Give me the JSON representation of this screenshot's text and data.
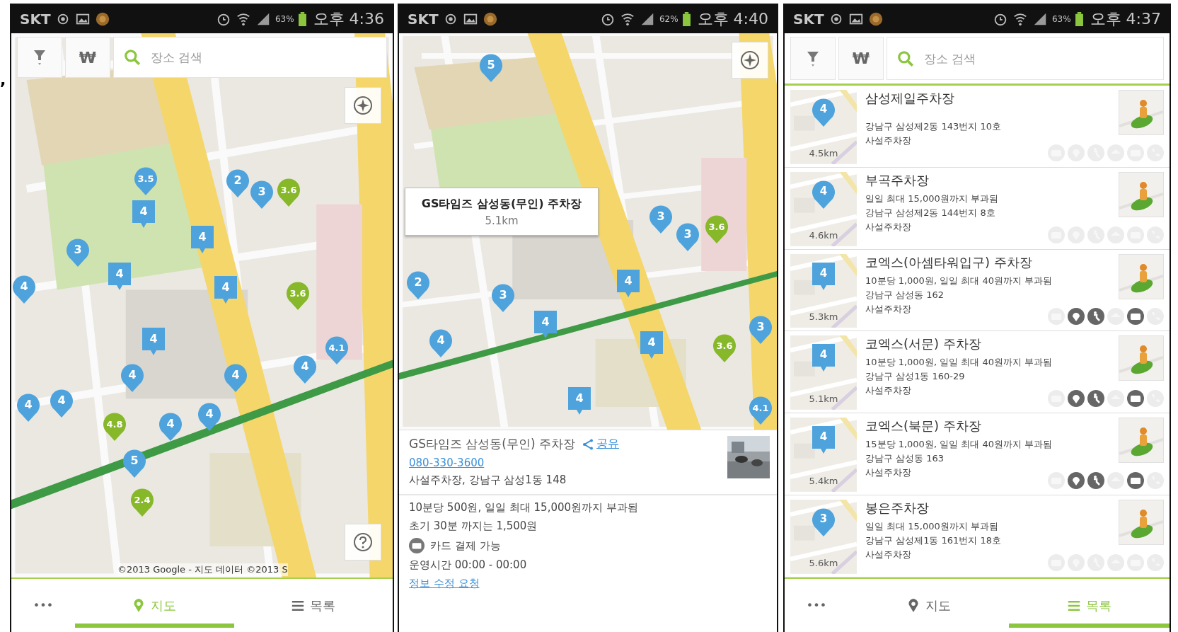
{
  "stray_mark": ",",
  "screens": [
    {
      "kind": "map",
      "status_bar": {
        "carrier": "SKT",
        "battery": "63%",
        "time": "오후 4:36"
      },
      "search": {
        "currency_label": "₩",
        "placeholder": "장소 검색"
      },
      "map": {
        "attribution": "©2013 Google - 지도 데이터 ©2013 S",
        "markers": [
          {
            "value": "3.5",
            "kind": "round",
            "color": "#4ea3dc"
          },
          {
            "value": "4",
            "kind": "square",
            "color": "#4ea3dc"
          },
          {
            "value": "2",
            "kind": "round",
            "color": "#4ea3dc"
          },
          {
            "value": "3",
            "kind": "round",
            "color": "#4ea3dc"
          },
          {
            "value": "3.6",
            "kind": "round",
            "color": "#86b82a"
          },
          {
            "value": "4",
            "kind": "square",
            "color": "#4ea3dc"
          },
          {
            "value": "3",
            "kind": "round",
            "color": "#4ea3dc"
          },
          {
            "value": "4",
            "kind": "square",
            "color": "#4ea3dc"
          },
          {
            "value": "4",
            "kind": "round",
            "color": "#4ea3dc"
          },
          {
            "value": "4",
            "kind": "square",
            "color": "#4ea3dc"
          },
          {
            "value": "3.6",
            "kind": "round",
            "color": "#86b82a"
          },
          {
            "value": "4",
            "kind": "square",
            "color": "#4ea3dc"
          },
          {
            "value": "4",
            "kind": "round",
            "color": "#4ea3dc"
          },
          {
            "value": "4",
            "kind": "round",
            "color": "#4ea3dc"
          },
          {
            "value": "4",
            "kind": "round",
            "color": "#4ea3dc"
          },
          {
            "value": "4.1",
            "kind": "round",
            "color": "#4ea3dc"
          },
          {
            "value": "4",
            "kind": "round",
            "color": "#4ea3dc"
          },
          {
            "value": "4",
            "kind": "round",
            "color": "#4ea3dc"
          },
          {
            "value": "4.8",
            "kind": "round",
            "color": "#86b82a"
          },
          {
            "value": "4",
            "kind": "round",
            "color": "#4ea3dc"
          },
          {
            "value": "4",
            "kind": "round",
            "color": "#4ea3dc"
          },
          {
            "value": "5",
            "kind": "round",
            "color": "#4ea3dc"
          },
          {
            "value": "2.4",
            "kind": "round",
            "color": "#86b82a"
          }
        ]
      },
      "bottom_nav": [
        {
          "kind": "more",
          "label": "•••",
          "selected": false
        },
        {
          "kind": "map",
          "label": "지도",
          "selected": true
        },
        {
          "kind": "list",
          "label": "목록",
          "selected": false
        }
      ]
    },
    {
      "kind": "detail",
      "status_bar": {
        "carrier": "SKT",
        "battery": "62%",
        "time": "오후 4:40"
      },
      "map": {
        "callout": {
          "title": "GS타임즈 삼성동(무인) 주차장",
          "distance": "5.1km"
        },
        "markers": [
          {
            "value": "5",
            "kind": "round",
            "color": "#4ea3dc"
          },
          {
            "value": "2",
            "kind": "round",
            "color": "#4ea3dc"
          },
          {
            "value": "3",
            "kind": "round",
            "color": "#4ea3dc"
          },
          {
            "value": "3",
            "kind": "round",
            "color": "#4ea3dc"
          },
          {
            "value": "3",
            "kind": "round",
            "color": "#4ea3dc"
          },
          {
            "value": "3.6",
            "kind": "round",
            "color": "#86b82a"
          },
          {
            "value": "4",
            "kind": "square",
            "color": "#4ea3dc"
          },
          {
            "value": "4",
            "kind": "square",
            "color": "#4ea3dc"
          },
          {
            "value": "4",
            "kind": "round",
            "color": "#4ea3dc"
          },
          {
            "value": "4",
            "kind": "square",
            "color": "#4ea3dc"
          },
          {
            "value": "3.6",
            "kind": "round",
            "color": "#86b82a"
          },
          {
            "value": "3",
            "kind": "round",
            "color": "#4ea3dc"
          },
          {
            "value": "4",
            "kind": "square",
            "color": "#4ea3dc"
          },
          {
            "value": "4.1",
            "kind": "round",
            "color": "#4ea3dc"
          }
        ]
      },
      "detail": {
        "title": "GS타임즈 삼성동(무인) 주차장",
        "share_label": "공유",
        "phone": "080-330-3600",
        "address": "사설주차장, 강남구 삼성1동 148",
        "info_lines": [
          {
            "kind": "text",
            "text": "10분당 500원, 일일 최대 15,000원까지 부과됨"
          },
          {
            "kind": "text",
            "text": "초기 30분 까지는 1,500원"
          },
          {
            "kind": "card",
            "text": "카드 결제 가능"
          },
          {
            "kind": "text",
            "text": "운영시간 00:00 - 00:00"
          },
          {
            "kind": "link",
            "text": "정보 수정 요청"
          }
        ]
      }
    },
    {
      "kind": "list",
      "status_bar": {
        "carrier": "SKT",
        "battery": "63%",
        "time": "오후 4:37"
      },
      "search": {
        "currency_label": "₩",
        "placeholder": "장소 검색"
      },
      "list": [
        {
          "name": "삼성제일주차장",
          "price": "4",
          "kind": "round",
          "distance": "4.5km",
          "lines": [
            "강남구 삼성제2동 143번지 10호",
            "사설주차장"
          ],
          "features": [
            {
              "kind": "card",
              "on": false
            },
            {
              "kind": "pin",
              "on": false
            },
            {
              "kind": "person",
              "on": false
            },
            {
              "kind": "roof",
              "on": false
            },
            {
              "kind": "pay",
              "on": false
            },
            {
              "kind": "phone",
              "on": false
            }
          ]
        },
        {
          "name": "부곡주차장",
          "price": "4",
          "kind": "round",
          "distance": "4.6km",
          "lines": [
            "일일 최대 15,000원까지 부과됨",
            "강남구 삼성제2동 144번지 8호",
            "사설주차장"
          ],
          "features": [
            {
              "kind": "card",
              "on": false
            },
            {
              "kind": "pin",
              "on": false
            },
            {
              "kind": "person",
              "on": false
            },
            {
              "kind": "roof",
              "on": false
            },
            {
              "kind": "pay",
              "on": false
            },
            {
              "kind": "phone",
              "on": false
            }
          ]
        },
        {
          "name": "코엑스(아셈타워입구) 주차장",
          "price": "4",
          "kind": "square",
          "distance": "5.3km",
          "lines": [
            "10분당 1,000원, 일일 최대 40원까지 부과됨",
            "강남구 삼성동 162",
            "사설주차장"
          ],
          "features": [
            {
              "kind": "card",
              "on": false
            },
            {
              "kind": "pin",
              "on": true
            },
            {
              "kind": "person",
              "on": true
            },
            {
              "kind": "roof",
              "on": false
            },
            {
              "kind": "pay",
              "on": true
            },
            {
              "kind": "phone",
              "on": false
            }
          ]
        },
        {
          "name": "코엑스(서문) 주차장",
          "price": "4",
          "kind": "square",
          "distance": "5.1km",
          "lines": [
            "10분당 1,000원, 일일 최대 40원까지 부과됨",
            "강남구 삼성1동 160-29",
            "사설주차장"
          ],
          "features": [
            {
              "kind": "card",
              "on": false
            },
            {
              "kind": "pin",
              "on": true
            },
            {
              "kind": "person",
              "on": true
            },
            {
              "kind": "roof",
              "on": false
            },
            {
              "kind": "pay",
              "on": true
            },
            {
              "kind": "phone",
              "on": false
            }
          ]
        },
        {
          "name": "코엑스(북문) 주차장",
          "price": "4",
          "kind": "square",
          "distance": "5.4km",
          "lines": [
            "15분당 1,000원, 일일 최대 40원까지 부과됨",
            "강남구 삼성동 163",
            "사설주차장"
          ],
          "features": [
            {
              "kind": "card",
              "on": false
            },
            {
              "kind": "pin",
              "on": true
            },
            {
              "kind": "person",
              "on": true
            },
            {
              "kind": "roof",
              "on": false
            },
            {
              "kind": "pay",
              "on": true
            },
            {
              "kind": "phone",
              "on": false
            }
          ]
        },
        {
          "name": "봉은주차장",
          "price": "3",
          "kind": "round",
          "distance": "5.6km",
          "lines": [
            "일일 최대 15,000원까지 부과됨",
            "강남구 삼성제1동 161번지 18호",
            "사설주차장"
          ],
          "features": [
            {
              "kind": "card",
              "on": false
            },
            {
              "kind": "pin",
              "on": false
            },
            {
              "kind": "person",
              "on": false
            },
            {
              "kind": "roof",
              "on": false
            },
            {
              "kind": "pay",
              "on": false
            },
            {
              "kind": "phone",
              "on": false
            }
          ]
        }
      ],
      "bottom_nav": [
        {
          "kind": "more",
          "label": "•••",
          "selected": false
        },
        {
          "kind": "map",
          "label": "지도",
          "selected": false
        },
        {
          "kind": "list",
          "label": "목록",
          "selected": true
        }
      ]
    }
  ]
}
